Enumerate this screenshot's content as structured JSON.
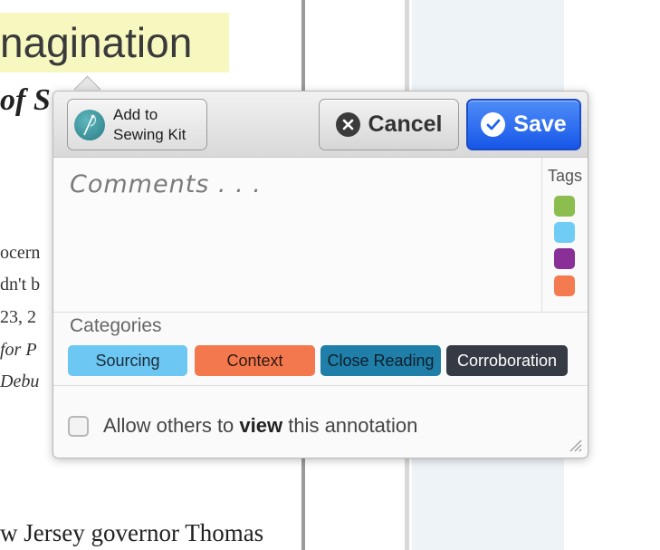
{
  "document": {
    "heading": "nagination",
    "subtitle": "of S",
    "fragments": [
      "ocern",
      "dn't b",
      "23, 2",
      "for P",
      "Debu"
    ],
    "bottom_line": "w Jersey governor Thomas"
  },
  "popup": {
    "sewing_kit_button": {
      "label_line1": "Add to",
      "label_line2": "Sewing Kit"
    },
    "cancel_button": {
      "label": "Cancel"
    },
    "save_button": {
      "label": "Save"
    },
    "comments": {
      "placeholder": "Comments . . .",
      "value": ""
    },
    "tags": {
      "title": "Tags",
      "swatches": [
        {
          "color": "#8bbd4f",
          "name": "green"
        },
        {
          "color": "#6fcdf5",
          "name": "light-blue"
        },
        {
          "color": "#8a2f97",
          "name": "purple"
        },
        {
          "color": "#f47a4f",
          "name": "orange"
        }
      ]
    },
    "categories": {
      "title": "Categories",
      "items": [
        {
          "label": "Sourcing",
          "bg": "#6cc8f2",
          "fg": "#1d2b3a"
        },
        {
          "label": "Context",
          "bg": "#f4784e",
          "fg": "#2b1a12"
        },
        {
          "label": "Close Reading",
          "bg": "#1f7fa8",
          "fg": "#0e1e2b"
        },
        {
          "label": "Corroboration",
          "bg": "#363a45",
          "fg": "#ffffff"
        }
      ]
    },
    "share": {
      "prefix": "Allow others to ",
      "emphasis": "view",
      "suffix": " this annotation",
      "checked": false
    }
  },
  "colors": {
    "save_blue": "#1f62ee",
    "header_gray": "#e2e2e2",
    "highlight": "#f7f7c0"
  }
}
